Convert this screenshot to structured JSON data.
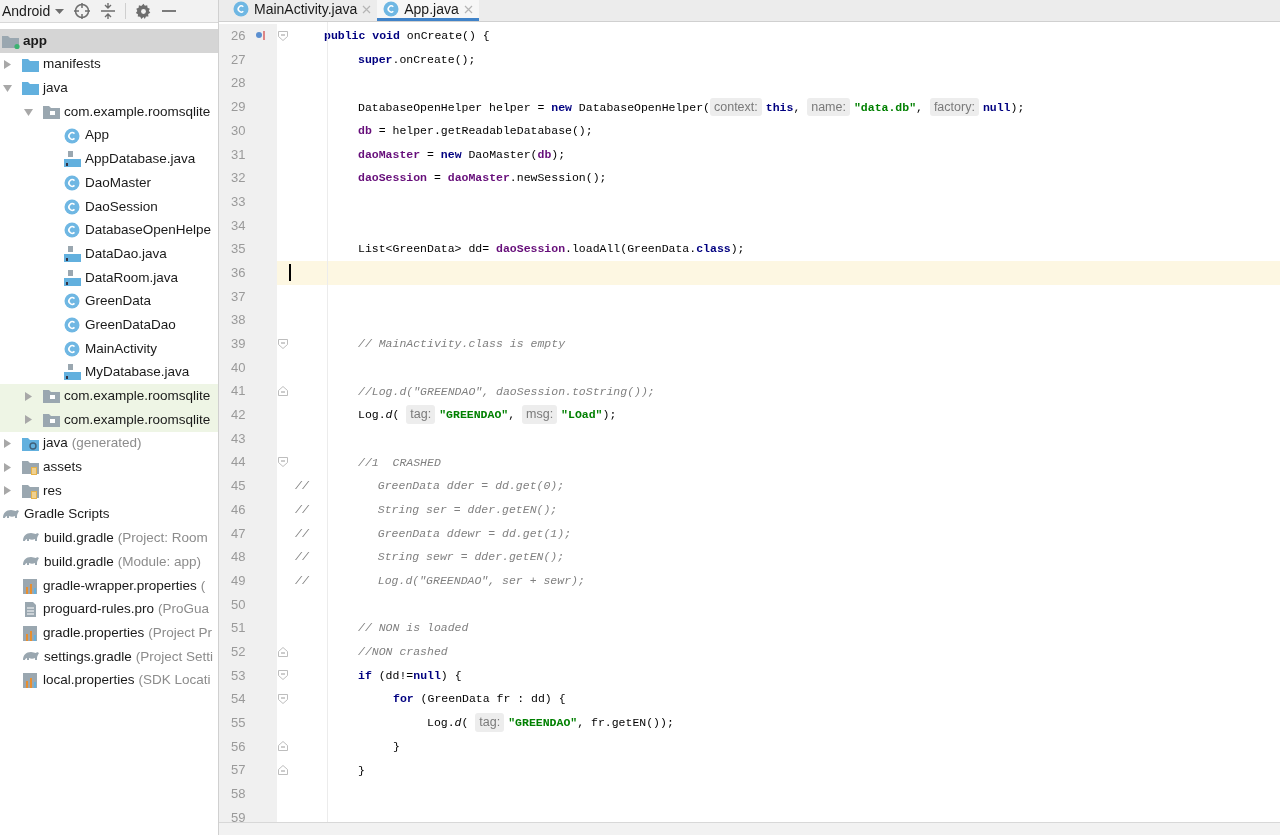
{
  "project_view": {
    "selector": "Android"
  },
  "tree": [
    {
      "label": "app",
      "kind": "module",
      "selected": true,
      "highlighted": false,
      "children": [
        {
          "label": "manifests",
          "kind": "folder",
          "selected": false,
          "highlighted": false,
          "expanded": false
        },
        {
          "label": "java",
          "kind": "folder",
          "selected": false,
          "highlighted": false,
          "expanded": true,
          "children": [
            {
              "label": "com.example.roomsqlite",
              "kind": "package",
              "selected": false,
              "highlighted": false,
              "expanded": true,
              "children": [
                {
                  "label": "App",
                  "kind": "class",
                  "selected": false,
                  "highlighted": false
                },
                {
                  "label": "AppDatabase.java",
                  "kind": "java-file",
                  "selected": false,
                  "highlighted": false
                },
                {
                  "label": "DaoMaster",
                  "kind": "class",
                  "selected": false,
                  "highlighted": false
                },
                {
                  "label": "DaoSession",
                  "kind": "class",
                  "selected": false,
                  "highlighted": false
                },
                {
                  "label": "DatabaseOpenHelpe",
                  "kind": "class",
                  "selected": false,
                  "highlighted": false
                },
                {
                  "label": "DataDao.java",
                  "kind": "java-file",
                  "selected": false,
                  "highlighted": false
                },
                {
                  "label": "DataRoom.java",
                  "kind": "java-file",
                  "selected": false,
                  "highlighted": false
                },
                {
                  "label": "GreenData",
                  "kind": "class",
                  "selected": false,
                  "highlighted": false
                },
                {
                  "label": "GreenDataDao",
                  "kind": "class",
                  "selected": false,
                  "highlighted": false
                },
                {
                  "label": "MainActivity",
                  "kind": "class",
                  "selected": false,
                  "highlighted": false
                },
                {
                  "label": "MyDatabase.java",
                  "kind": "java-file",
                  "selected": false,
                  "highlighted": false
                }
              ]
            },
            {
              "label": "com.example.roomsqlite",
              "kind": "package",
              "selected": false,
              "highlighted": true,
              "expanded": false
            },
            {
              "label": "com.example.roomsqlite",
              "kind": "package",
              "selected": false,
              "highlighted": true,
              "expanded": false
            }
          ]
        },
        {
          "label": "java",
          "note": "(generated)",
          "kind": "generated-folder",
          "selected": false,
          "highlighted": false,
          "expanded": false
        },
        {
          "label": "assets",
          "kind": "resource-folder",
          "selected": false,
          "highlighted": false,
          "expanded": false
        },
        {
          "label": "res",
          "kind": "resource-folder",
          "selected": false,
          "highlighted": false,
          "expanded": false
        }
      ]
    },
    {
      "label": "Gradle Scripts",
      "kind": "gradle",
      "selected": false,
      "highlighted": false,
      "children": [
        {
          "label": "build.gradle",
          "note": "(Project: Room",
          "kind": "gradle",
          "selected": false,
          "highlighted": false
        },
        {
          "label": "build.gradle",
          "note": "(Module: app)",
          "kind": "gradle",
          "selected": false,
          "highlighted": false
        },
        {
          "label": "gradle-wrapper.properties",
          "note": "(",
          "kind": "properties",
          "selected": false,
          "highlighted": false
        },
        {
          "label": "proguard-rules.pro",
          "note": "(ProGua",
          "kind": "text-file",
          "selected": false,
          "highlighted": false
        },
        {
          "label": "gradle.properties",
          "note": "(Project Pr",
          "kind": "properties",
          "selected": false,
          "highlighted": false
        },
        {
          "label": "settings.gradle",
          "note": "(Project Setti",
          "kind": "gradle",
          "selected": false,
          "highlighted": false
        },
        {
          "label": "local.properties",
          "note": "(SDK Locati",
          "kind": "properties",
          "selected": false,
          "highlighted": false
        }
      ]
    }
  ],
  "tabs": [
    {
      "label": "MainActivity.java",
      "selected": false
    },
    {
      "label": "App.java",
      "selected": true
    }
  ],
  "editor": {
    "lines": [
      {
        "number": "26",
        "kind": "member",
        "current": false,
        "fold_start": true,
        "fold_end": false,
        "marker": true,
        "tokens": [
          {
            "kind": "keyword",
            "text": "public void"
          },
          {
            "kind": "plain",
            "text": " onCreate() {"
          }
        ]
      },
      {
        "number": "27",
        "kind": "body",
        "current": false,
        "fold_start": false,
        "fold_end": false,
        "marker": false,
        "tokens": [
          {
            "kind": "keyword",
            "text": "super"
          },
          {
            "kind": "plain",
            "text": ".onCreate();"
          }
        ]
      },
      {
        "number": "28",
        "kind": "body",
        "current": false,
        "fold_start": false,
        "fold_end": false,
        "marker": false
      },
      {
        "number": "29",
        "kind": "body",
        "current": false,
        "fold_start": false,
        "fold_end": false,
        "marker": false,
        "tokens": [
          {
            "kind": "plain",
            "text": "DatabaseOpenHelper helper = "
          },
          {
            "kind": "keyword",
            "text": "new"
          },
          {
            "kind": "plain",
            "text": " DatabaseOpenHelper("
          },
          {
            "kind": "hint",
            "text": "context:"
          },
          {
            "kind": "keyword",
            "text": "this"
          },
          {
            "kind": "plain",
            "text": ", "
          },
          {
            "kind": "hint",
            "text": "name:"
          },
          {
            "kind": "string",
            "text": "\"data.db\""
          },
          {
            "kind": "plain",
            "text": ", "
          },
          {
            "kind": "hint",
            "text": "factory:"
          },
          {
            "kind": "keyword",
            "text": "null"
          },
          {
            "kind": "plain",
            "text": ");"
          }
        ]
      },
      {
        "number": "30",
        "kind": "body",
        "current": false,
        "fold_start": false,
        "fold_end": false,
        "marker": false,
        "tokens": [
          {
            "kind": "field",
            "text": "db"
          },
          {
            "kind": "plain",
            "text": " = helper.getReadableDatabase();"
          }
        ]
      },
      {
        "number": "31",
        "kind": "body",
        "current": false,
        "fold_start": false,
        "fold_end": false,
        "marker": false,
        "tokens": [
          {
            "kind": "field",
            "text": "daoMaster"
          },
          {
            "kind": "plain",
            "text": " = "
          },
          {
            "kind": "keyword",
            "text": "new"
          },
          {
            "kind": "plain",
            "text": " DaoMaster("
          },
          {
            "kind": "field",
            "text": "db"
          },
          {
            "kind": "plain",
            "text": ");"
          }
        ]
      },
      {
        "number": "32",
        "kind": "body",
        "current": false,
        "fold_start": false,
        "fold_end": false,
        "marker": false,
        "tokens": [
          {
            "kind": "field",
            "text": "daoSession"
          },
          {
            "kind": "plain",
            "text": " = "
          },
          {
            "kind": "field",
            "text": "daoMaster"
          },
          {
            "kind": "plain",
            "text": ".newSession();"
          }
        ]
      },
      {
        "number": "33",
        "kind": "body",
        "current": false,
        "fold_start": false,
        "fold_end": false,
        "marker": false
      },
      {
        "number": "34",
        "kind": "body",
        "current": false,
        "fold_start": false,
        "fold_end": false,
        "marker": false
      },
      {
        "number": "35",
        "kind": "body",
        "current": false,
        "fold_start": false,
        "fold_end": false,
        "marker": false,
        "tokens": [
          {
            "kind": "plain",
            "text": "List<GreenData> dd= "
          },
          {
            "kind": "field",
            "text": "daoSession"
          },
          {
            "kind": "plain",
            "text": ".loadAll(GreenData."
          },
          {
            "kind": "keyword",
            "text": "class"
          },
          {
            "kind": "plain",
            "text": ");"
          }
        ]
      },
      {
        "number": "36",
        "kind": "body",
        "current": true,
        "fold_start": false,
        "fold_end": false,
        "marker": false
      },
      {
        "number": "37",
        "kind": "body",
        "current": false,
        "fold_start": false,
        "fold_end": false,
        "marker": false
      },
      {
        "number": "38",
        "kind": "body",
        "current": false,
        "fold_start": false,
        "fold_end": false,
        "marker": false
      },
      {
        "number": "39",
        "kind": "body",
        "current": false,
        "fold_start": true,
        "fold_end": false,
        "marker": false,
        "tokens": [
          {
            "kind": "comment",
            "text": "// MainActivity.class is empty"
          }
        ]
      },
      {
        "number": "40",
        "kind": "body",
        "current": false,
        "fold_start": false,
        "fold_end": false,
        "marker": false
      },
      {
        "number": "41",
        "kind": "body",
        "current": false,
        "fold_start": false,
        "fold_end": true,
        "marker": false,
        "tokens": [
          {
            "kind": "comment",
            "text": "//Log.d(\"GREENDAO\", daoSession.toString());"
          }
        ]
      },
      {
        "number": "42",
        "kind": "body",
        "current": false,
        "fold_start": false,
        "fold_end": false,
        "marker": false,
        "tokens": [
          {
            "kind": "plain",
            "text": "Log."
          },
          {
            "kind": "italic",
            "text": "d"
          },
          {
            "kind": "plain",
            "text": "( "
          },
          {
            "kind": "hint",
            "text": "tag:"
          },
          {
            "kind": "string",
            "text": "\"GREENDAO\""
          },
          {
            "kind": "plain",
            "text": ", "
          },
          {
            "kind": "hint",
            "text": "msg:"
          },
          {
            "kind": "string",
            "text": "\"LOad\""
          },
          {
            "kind": "plain",
            "text": ");"
          }
        ]
      },
      {
        "number": "43",
        "kind": "body",
        "current": false,
        "fold_start": false,
        "fold_end": false,
        "marker": false
      },
      {
        "number": "44",
        "kind": "body",
        "current": false,
        "fold_start": true,
        "fold_end": false,
        "marker": false,
        "tokens": [
          {
            "kind": "comment",
            "text": "//1  CRASHED"
          }
        ]
      },
      {
        "number": "45",
        "kind": "commented-out",
        "current": false,
        "fold_start": false,
        "fold_end": false,
        "marker": false,
        "tokens": [
          {
            "kind": "comment",
            "text": "//          GreenData dder = dd.get(0);"
          }
        ]
      },
      {
        "number": "46",
        "kind": "commented-out",
        "current": false,
        "fold_start": false,
        "fold_end": false,
        "marker": false,
        "tokens": [
          {
            "kind": "comment",
            "text": "//          String ser = dder.getEN();"
          }
        ]
      },
      {
        "number": "47",
        "kind": "commented-out",
        "current": false,
        "fold_start": false,
        "fold_end": false,
        "marker": false,
        "tokens": [
          {
            "kind": "comment",
            "text": "//          GreenData ddewr = dd.get(1);"
          }
        ]
      },
      {
        "number": "48",
        "kind": "commented-out",
        "current": false,
        "fold_start": false,
        "fold_end": false,
        "marker": false,
        "tokens": [
          {
            "kind": "comment",
            "text": "//          String sewr = dder.getEN();"
          }
        ]
      },
      {
        "number": "49",
        "kind": "commented-out",
        "current": false,
        "fold_start": false,
        "fold_end": false,
        "marker": false,
        "tokens": [
          {
            "kind": "comment",
            "text": "//          Log.d(\"GREENDAO\", ser + sewr);"
          }
        ]
      },
      {
        "number": "50",
        "kind": "body",
        "current": false,
        "fold_start": false,
        "fold_end": false,
        "marker": false
      },
      {
        "number": "51",
        "kind": "body",
        "current": false,
        "fold_start": false,
        "fold_end": false,
        "marker": false,
        "tokens": [
          {
            "kind": "comment",
            "text": "// NON is loaded"
          }
        ]
      },
      {
        "number": "52",
        "kind": "body",
        "current": false,
        "fold_start": false,
        "fold_end": true,
        "marker": false,
        "tokens": [
          {
            "kind": "comment",
            "text": "//NON crashed"
          }
        ]
      },
      {
        "number": "53",
        "kind": "body",
        "current": false,
        "fold_start": true,
        "fold_end": false,
        "marker": false,
        "tokens": [
          {
            "kind": "keyword",
            "text": "if"
          },
          {
            "kind": "plain",
            "text": " (dd!="
          },
          {
            "kind": "keyword",
            "text": "null"
          },
          {
            "kind": "plain",
            "text": ") {"
          }
        ]
      },
      {
        "number": "54",
        "kind": "block",
        "current": false,
        "fold_start": true,
        "fold_end": false,
        "marker": false,
        "tokens": [
          {
            "kind": "keyword",
            "text": "for"
          },
          {
            "kind": "plain",
            "text": " (GreenData fr : dd) {"
          }
        ]
      },
      {
        "number": "55",
        "kind": "inner",
        "current": false,
        "fold_start": false,
        "fold_end": false,
        "marker": false,
        "tokens": [
          {
            "kind": "plain",
            "text": "Log."
          },
          {
            "kind": "italic",
            "text": "d"
          },
          {
            "kind": "plain",
            "text": "( "
          },
          {
            "kind": "hint",
            "text": "tag:"
          },
          {
            "kind": "string",
            "text": "\"GREENDAO\""
          },
          {
            "kind": "plain",
            "text": ", fr.getEN());"
          }
        ]
      },
      {
        "number": "56",
        "kind": "block",
        "current": false,
        "fold_start": false,
        "fold_end": true,
        "marker": false,
        "tokens": [
          {
            "kind": "plain",
            "text": "}"
          }
        ]
      },
      {
        "number": "57",
        "kind": "body",
        "current": false,
        "fold_start": false,
        "fold_end": true,
        "marker": false,
        "tokens": [
          {
            "kind": "plain",
            "text": "}"
          }
        ]
      },
      {
        "number": "58",
        "kind": "body",
        "current": false,
        "fold_start": false,
        "fold_end": false,
        "marker": false
      },
      {
        "number": "59",
        "kind": "body",
        "current": false,
        "fold_start": false,
        "fold_end": false,
        "marker": false
      }
    ]
  }
}
